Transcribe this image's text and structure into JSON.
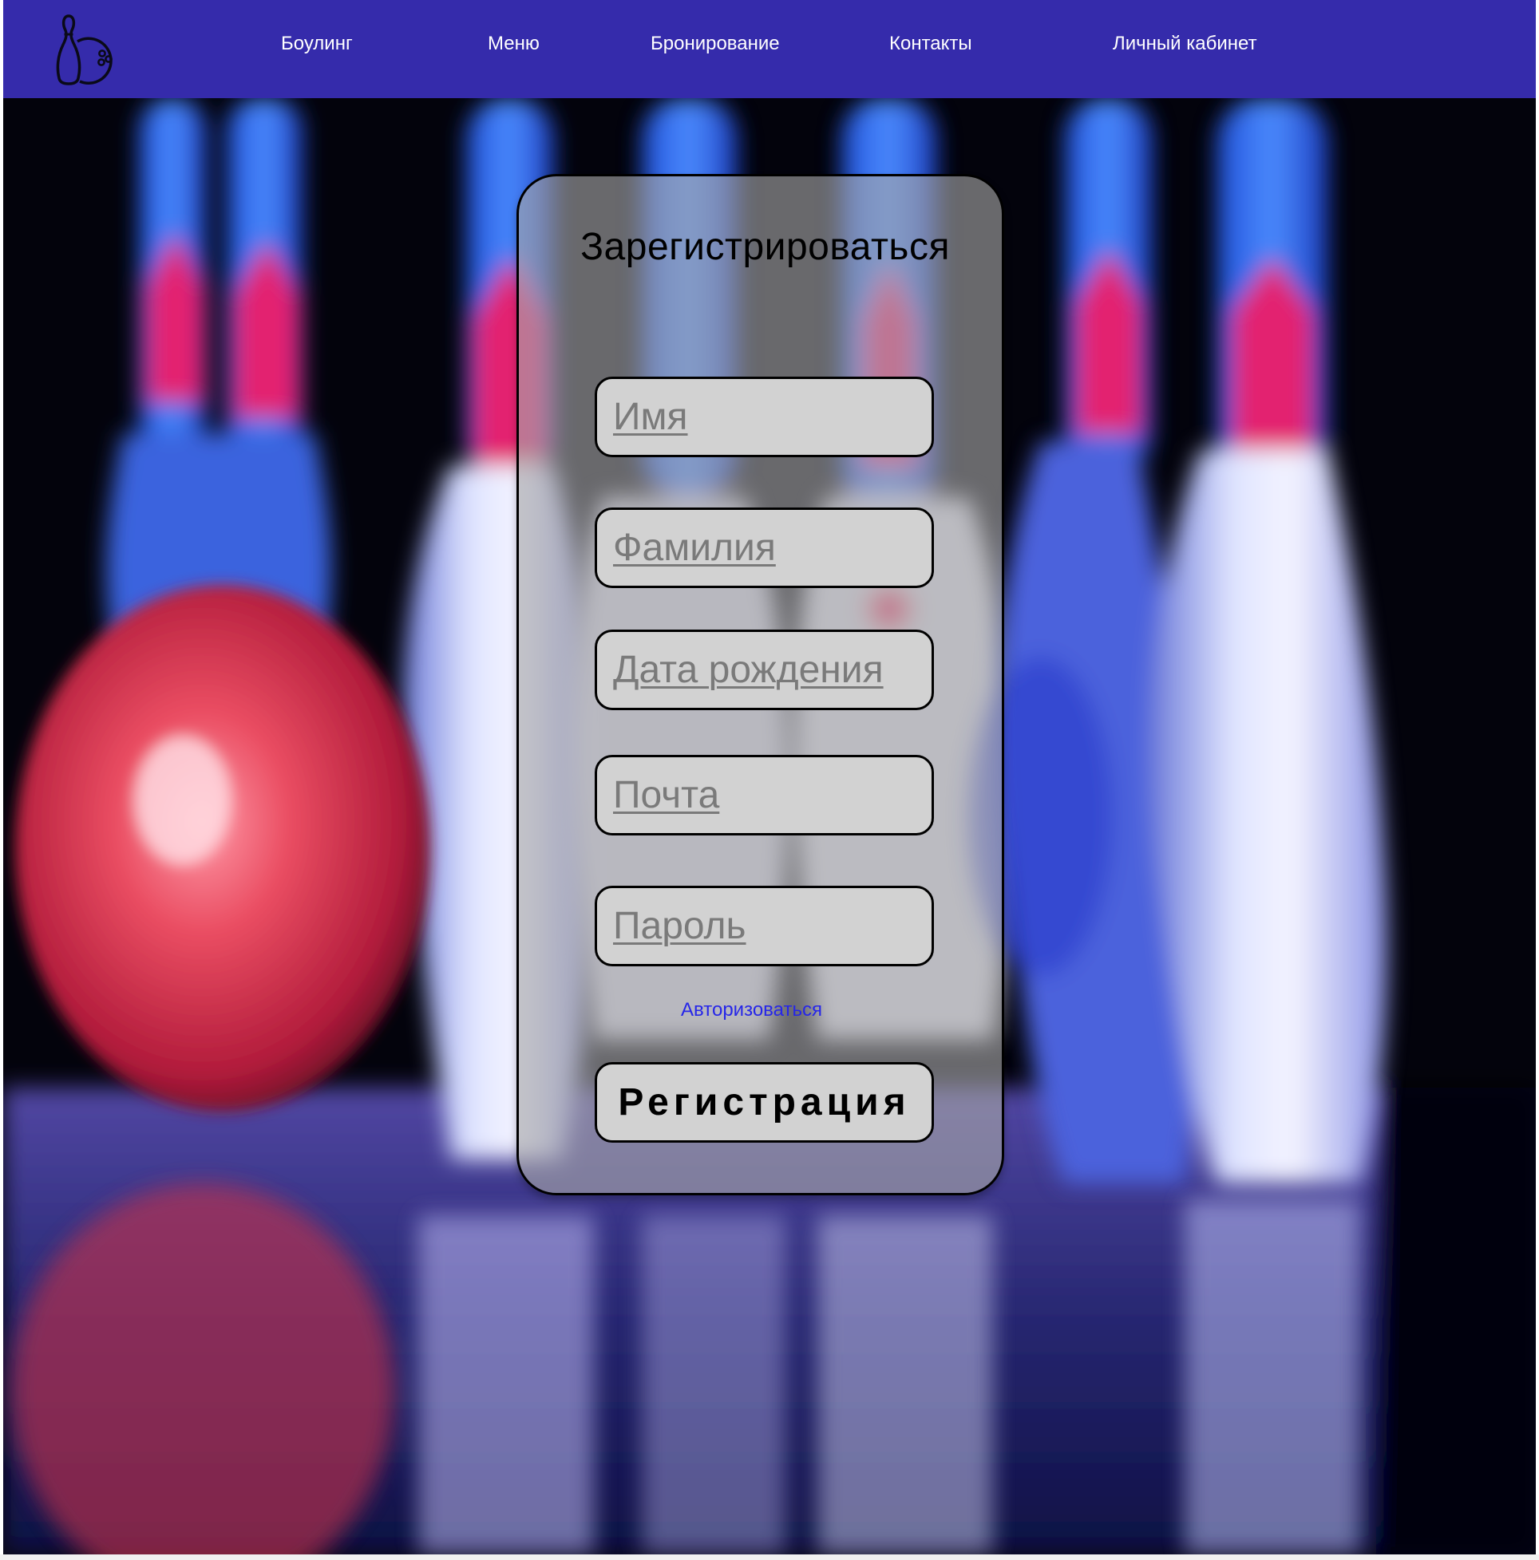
{
  "header": {
    "logo_icon": "bowling-pin-and-ball-icon",
    "nav": [
      {
        "label": "Боулинг"
      },
      {
        "label": "Меню"
      },
      {
        "label": "Бронирование"
      },
      {
        "label": "Контакты"
      },
      {
        "label": "Личный кабинет"
      }
    ],
    "background_color": "#352bab"
  },
  "hero": {
    "background": "blurred photo of bowling ball and pins"
  },
  "form": {
    "title": "Зарегистрироваться",
    "fields": [
      {
        "placeholder": "Имя"
      },
      {
        "placeholder": "Фамилия"
      },
      {
        "placeholder": "Дата рождения"
      },
      {
        "placeholder": "Почта"
      },
      {
        "placeholder": "Пароль"
      }
    ],
    "login_link": "Авторизоваться",
    "submit_label": "Регистрация"
  },
  "colors": {
    "header": "#352bab",
    "link": "#2626e8",
    "field_bg": "#d2d2d2"
  }
}
